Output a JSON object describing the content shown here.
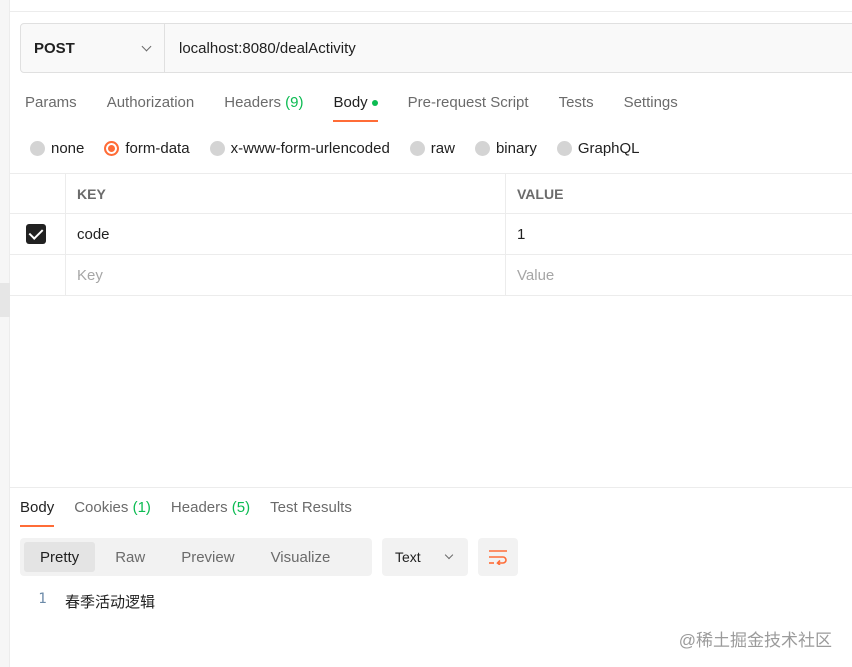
{
  "request": {
    "method": "POST",
    "url": "localhost:8080/dealActivity"
  },
  "request_tabs": [
    {
      "label": "Params"
    },
    {
      "label": "Authorization"
    },
    {
      "label": "Headers",
      "count": "(9)"
    },
    {
      "label": "Body"
    },
    {
      "label": "Pre-request Script"
    },
    {
      "label": "Tests"
    },
    {
      "label": "Settings"
    }
  ],
  "body_types": [
    "none",
    "form-data",
    "x-www-form-urlencoded",
    "raw",
    "binary",
    "GraphQL"
  ],
  "body_type_selected": "form-data",
  "kv_table": {
    "key_header": "KEY",
    "value_header": "VALUE",
    "rows": [
      {
        "checked": true,
        "key": "code",
        "value": "1"
      }
    ],
    "key_placeholder": "Key",
    "value_placeholder": "Value"
  },
  "response_tabs": [
    {
      "label": "Body"
    },
    {
      "label": "Cookies",
      "count": "(1)"
    },
    {
      "label": "Headers",
      "count": "(5)"
    },
    {
      "label": "Test Results"
    }
  ],
  "response_views": [
    "Pretty",
    "Raw",
    "Preview",
    "Visualize"
  ],
  "response_format": "Text",
  "response_body": {
    "line_number": "1",
    "text": "春季活动逻辑"
  },
  "watermark": "@稀土掘金技术社区",
  "colors": {
    "accent": "#ff6c37",
    "count_green": "#0cbb52"
  }
}
